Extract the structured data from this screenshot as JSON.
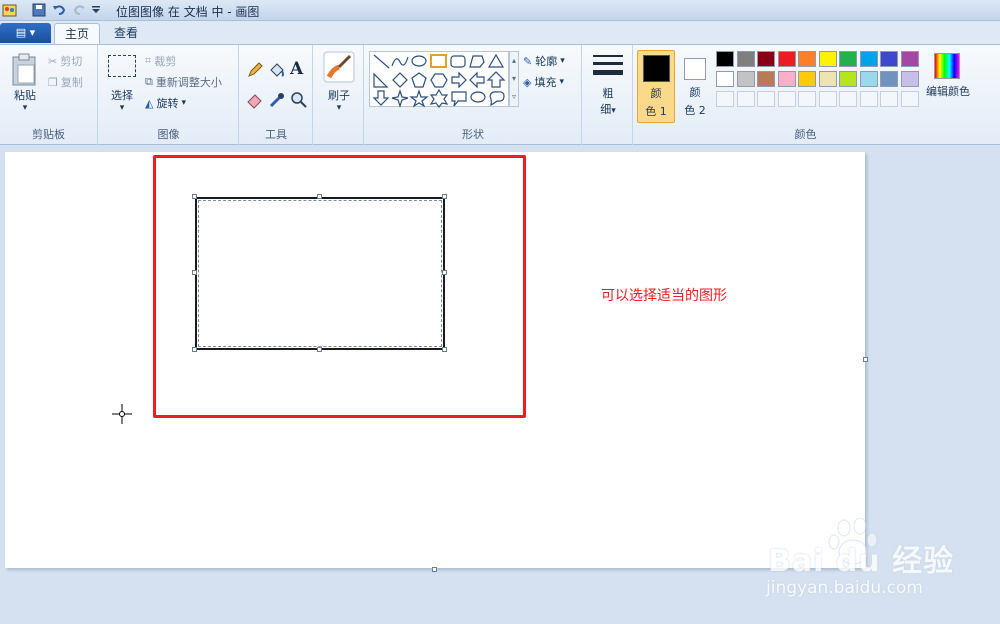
{
  "window": {
    "title": "位图图像 在 文档 中 - 画图"
  },
  "tabs": {
    "file": "▤ ▾",
    "home": "主页",
    "view": "查看"
  },
  "clipboard": {
    "paste": "粘贴",
    "cut": "剪切",
    "copy": "复制",
    "group": "剪贴板"
  },
  "image": {
    "select": "选择",
    "crop": "裁剪",
    "resize": "重新调整大小",
    "rotate": "旋转",
    "group": "图像"
  },
  "tools": {
    "group": "工具"
  },
  "brushes": {
    "label": "刷子"
  },
  "shapes": {
    "outline": "轮廓",
    "fill": "填充",
    "group": "形状"
  },
  "size": {
    "label_top": "粗",
    "label_bottom": "细"
  },
  "colors": {
    "color1_top": "颜",
    "color1_bottom": "色 1",
    "color2_top": "颜",
    "color2_bottom": "色 2",
    "edit": "编辑颜色",
    "group": "颜色",
    "palette_row1": [
      "#000000",
      "#7f7f7f",
      "#880015",
      "#ed1c24",
      "#ff7f27",
      "#fff200",
      "#22b14c",
      "#00a2e8",
      "#3f48cc",
      "#a349a4"
    ],
    "palette_row2": [
      "#ffffff",
      "#c3c3c3",
      "#b97a57",
      "#ffaec9",
      "#ffc90e",
      "#efe4b0",
      "#b5e61d",
      "#99d9ea",
      "#7092be",
      "#c8bfe7"
    ],
    "primary": "#000000",
    "secondary": "#ffffff"
  },
  "canvas": {
    "annotation": "可以选择适当的图形"
  },
  "watermark": {
    "brand": "Bai du 经验",
    "url": "jingyan.baidu.com"
  }
}
